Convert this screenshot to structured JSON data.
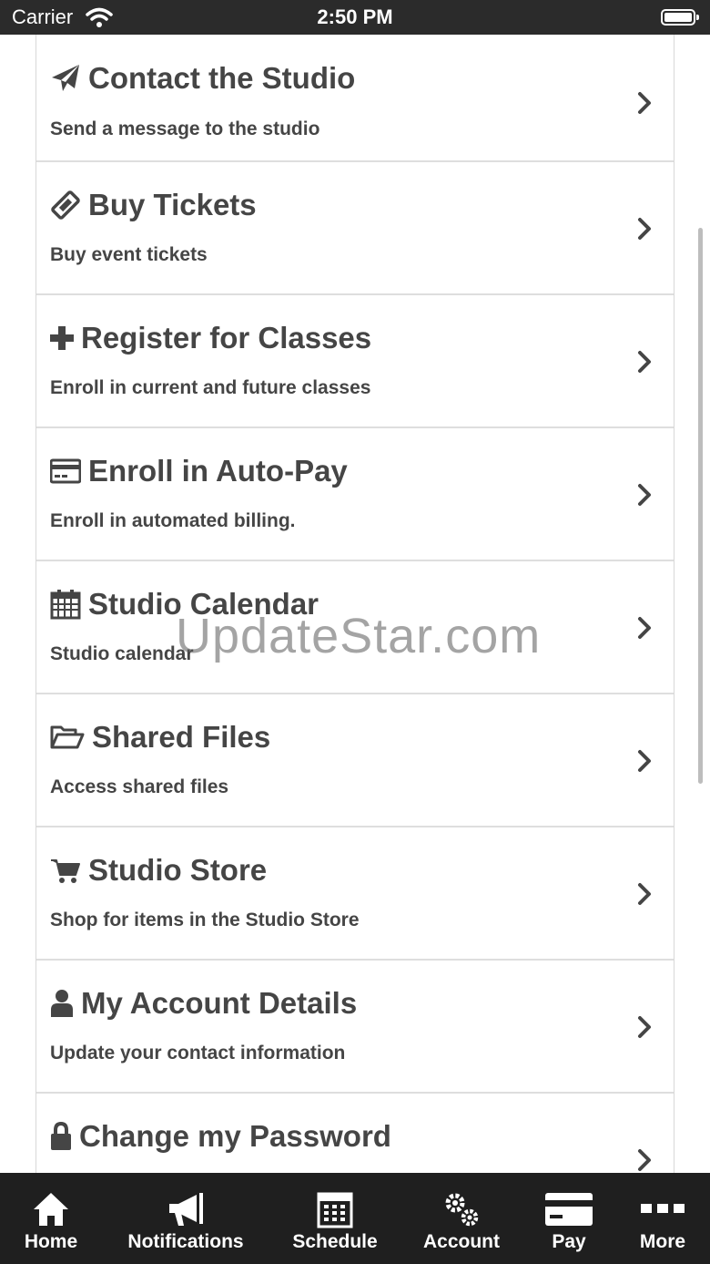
{
  "status_bar": {
    "carrier": "Carrier",
    "time": "2:50 PM"
  },
  "menu": {
    "items": [
      {
        "title": "Contact the Studio",
        "subtitle": "Send a message to the studio",
        "icon": "paper-plane-icon"
      },
      {
        "title": "Buy Tickets",
        "subtitle": "Buy event tickets",
        "icon": "ticket-icon"
      },
      {
        "title": "Register for Classes",
        "subtitle": "Enroll in current and future classes",
        "icon": "plus-icon"
      },
      {
        "title": "Enroll in Auto-Pay",
        "subtitle": "Enroll in automated billing.",
        "icon": "credit-card-icon"
      },
      {
        "title": "Studio Calendar",
        "subtitle": "Studio calendar",
        "icon": "calendar-icon"
      },
      {
        "title": "Shared Files",
        "subtitle": "Access shared files",
        "icon": "folder-open-icon"
      },
      {
        "title": "Studio Store",
        "subtitle": "Shop for items in the Studio Store",
        "icon": "shopping-cart-icon"
      },
      {
        "title": "My Account Details",
        "subtitle": "Update your contact information",
        "icon": "user-icon"
      },
      {
        "title": "Change my Password",
        "subtitle": "",
        "icon": "lock-icon"
      }
    ]
  },
  "watermark": "UpdateStar.com",
  "tab_bar": {
    "tabs": [
      {
        "label": "Home",
        "icon": "home-icon"
      },
      {
        "label": "Notifications",
        "icon": "megaphone-icon"
      },
      {
        "label": "Schedule",
        "icon": "calendar-grid-icon"
      },
      {
        "label": "Account",
        "icon": "gears-icon"
      },
      {
        "label": "Pay",
        "icon": "credit-card-icon"
      },
      {
        "label": "More",
        "icon": "more-dots-icon"
      }
    ]
  },
  "colors": {
    "status_bar_bg": "#2b2b2b",
    "tab_bar_bg": "#1f1f1f",
    "text": "#454545",
    "divider": "#dedede"
  }
}
